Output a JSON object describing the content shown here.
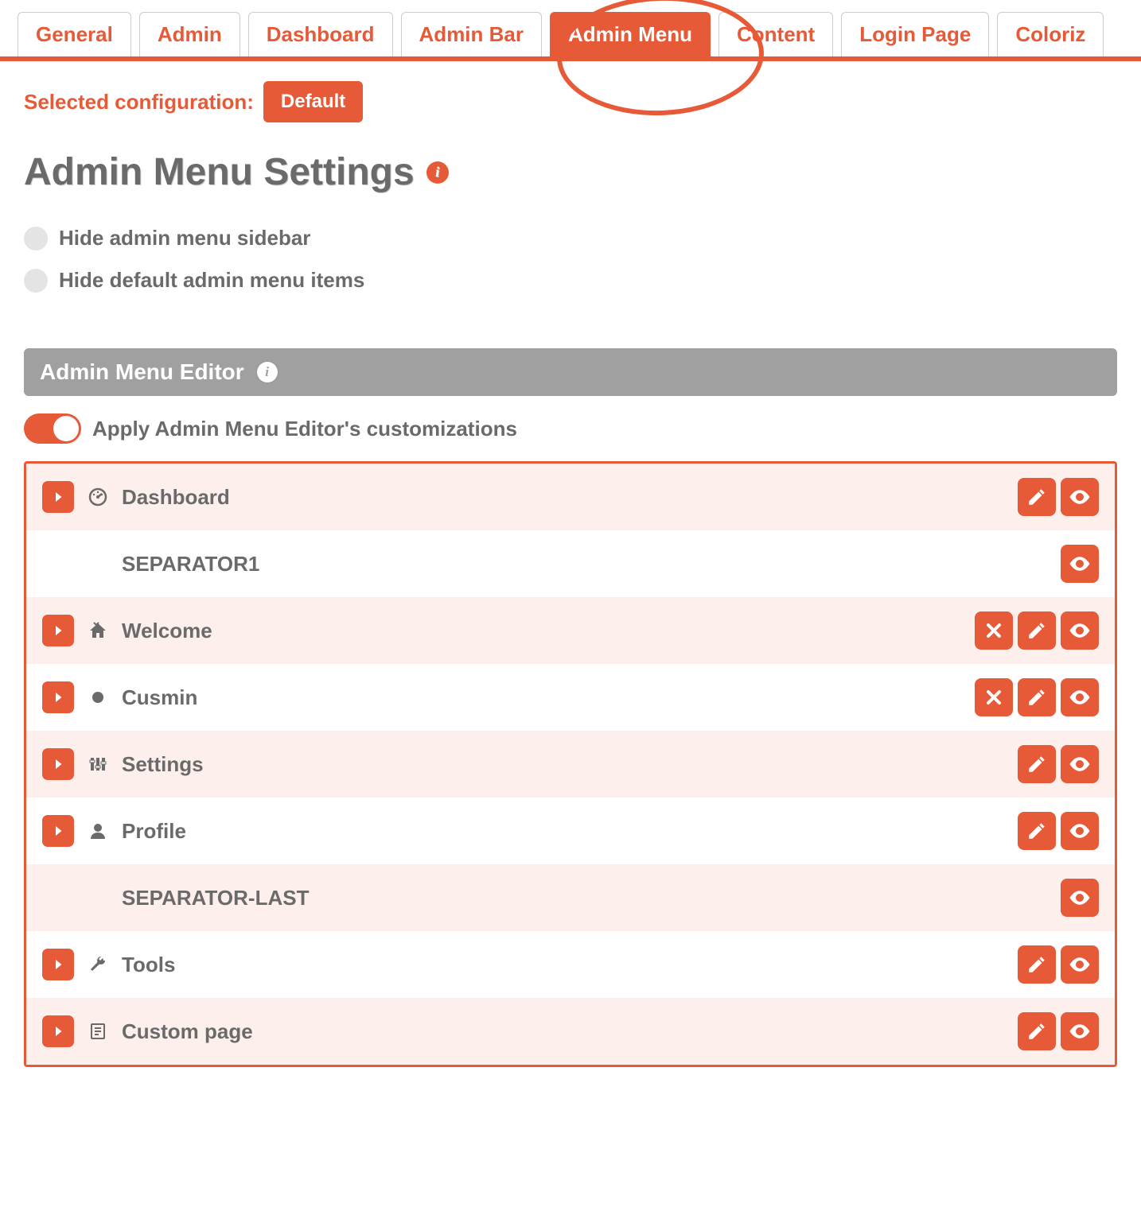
{
  "tabs": [
    {
      "label": "General",
      "active": false
    },
    {
      "label": "Admin",
      "active": false
    },
    {
      "label": "Dashboard",
      "active": false
    },
    {
      "label": "Admin Bar",
      "active": false
    },
    {
      "label": "Admin Menu",
      "active": true
    },
    {
      "label": "Content",
      "active": false
    },
    {
      "label": "Login Page",
      "active": false
    },
    {
      "label": "Coloriz",
      "active": false
    }
  ],
  "config": {
    "label": "Selected configuration:",
    "button": "Default"
  },
  "page_title": "Admin Menu Settings",
  "checkboxes": [
    {
      "label": "Hide admin menu sidebar"
    },
    {
      "label": "Hide default admin menu items"
    }
  ],
  "editor_header": "Admin Menu Editor",
  "toggle_label": "Apply Admin Menu Editor's customizations",
  "menu_items": [
    {
      "label": "Dashboard",
      "icon": "gauge",
      "bg": "light",
      "expand": true,
      "actions": [
        "edit",
        "eye"
      ]
    },
    {
      "label": "SEPARATOR1",
      "icon": null,
      "bg": "white",
      "expand": false,
      "actions": [
        "eye"
      ]
    },
    {
      "label": "Welcome",
      "icon": "home",
      "bg": "light",
      "expand": true,
      "actions": [
        "close",
        "edit",
        "eye"
      ]
    },
    {
      "label": "Cusmin",
      "icon": "dot",
      "bg": "white",
      "expand": true,
      "actions": [
        "close",
        "edit",
        "eye"
      ]
    },
    {
      "label": "Settings",
      "icon": "sliders",
      "bg": "light",
      "expand": true,
      "actions": [
        "edit",
        "eye"
      ]
    },
    {
      "label": "Profile",
      "icon": "user",
      "bg": "white",
      "expand": true,
      "actions": [
        "edit",
        "eye"
      ]
    },
    {
      "label": "SEPARATOR-LAST",
      "icon": null,
      "bg": "light",
      "expand": false,
      "actions": [
        "eye"
      ]
    },
    {
      "label": "Tools",
      "icon": "wrench",
      "bg": "white",
      "expand": true,
      "actions": [
        "edit",
        "eye"
      ]
    },
    {
      "label": "Custom page",
      "icon": "page",
      "bg": "light",
      "expand": true,
      "actions": [
        "edit",
        "eye"
      ]
    }
  ]
}
